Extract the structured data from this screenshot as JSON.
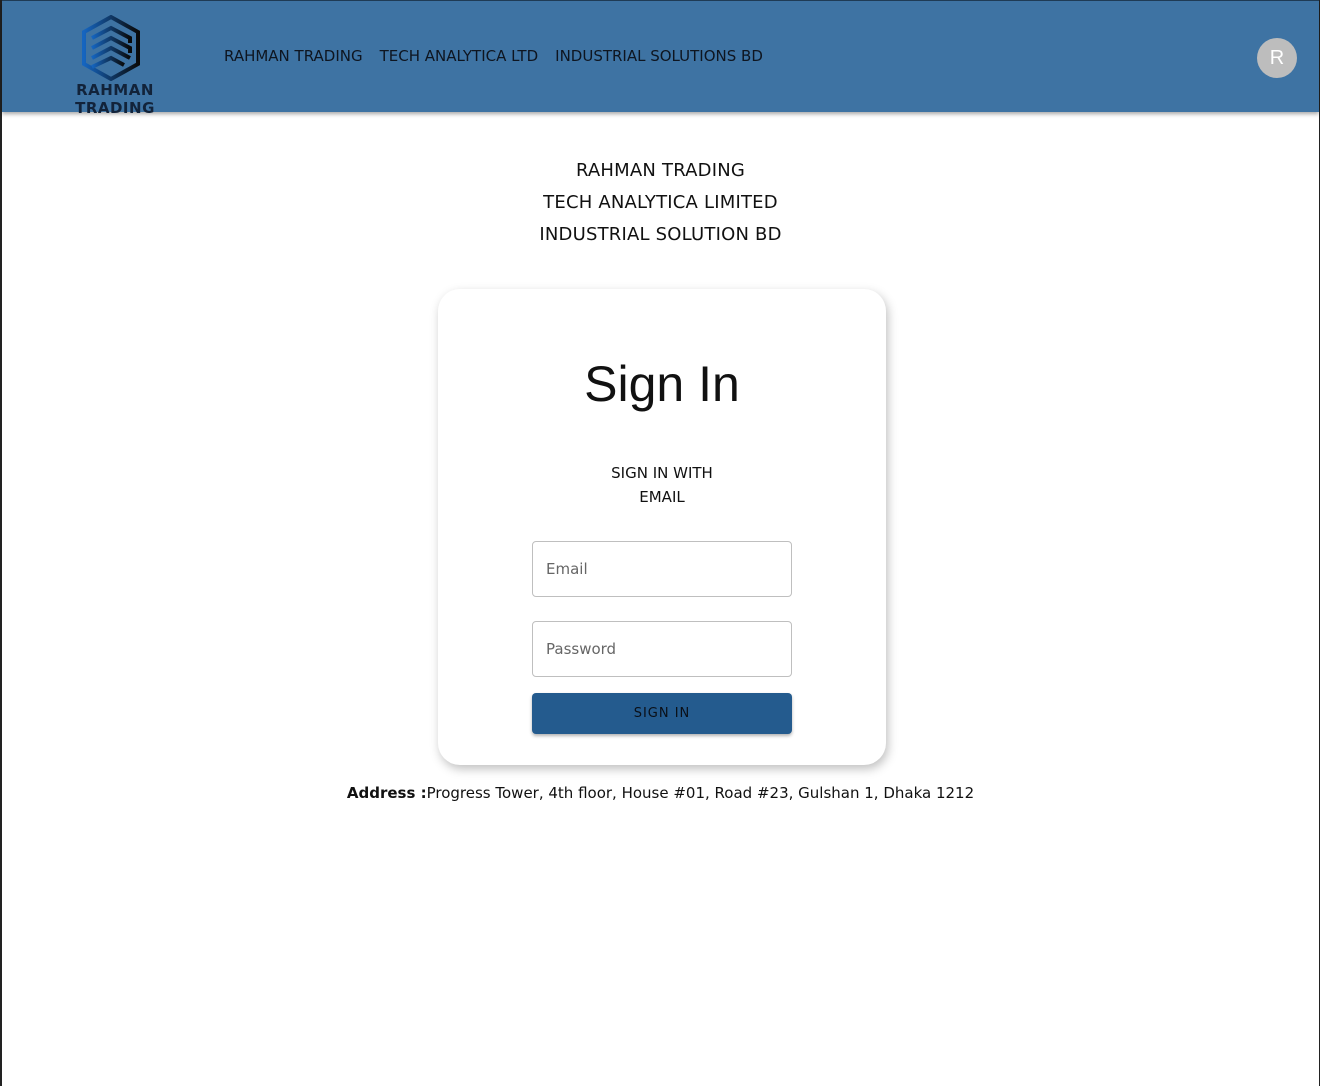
{
  "header": {
    "logo_text": "RAHMAN TRADING",
    "logo_icon": "hexagon-logo-icon",
    "nav": [
      {
        "label": "RAHMAN TRADING"
      },
      {
        "label": "TECH ANALYTICA LTD"
      },
      {
        "label": "INDUSTRIAL SOLUTIONS BD"
      }
    ],
    "avatar_initial": "R"
  },
  "companies": [
    "RAHMAN TRADING",
    "TECH ANALYTICA LIMITED",
    "INDUSTRIAL SOLUTION BD"
  ],
  "signin": {
    "title": "Sign In",
    "subtitle_line1": "SIGN IN WITH",
    "subtitle_line2": "EMAIL",
    "email_placeholder": "Email",
    "password_placeholder": "Password",
    "button_label": "SIGN IN"
  },
  "footer": {
    "address_label": "Address :",
    "address_text": "Progress Tower, 4th floor, House #01, Road #23, Gulshan 1, Dhaka 1212"
  },
  "colors": {
    "appbar": "#3e73a3",
    "button": "#245b8e",
    "avatar": "#bdbdbd"
  }
}
